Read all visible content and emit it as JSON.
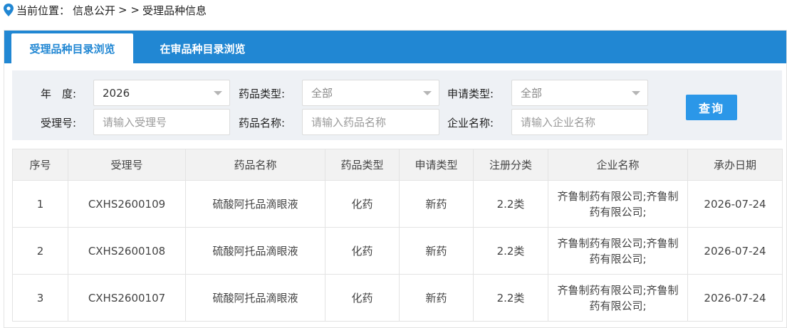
{
  "breadcrumb": {
    "prefix": "当前位置：",
    "item1": "信息公开",
    "separator": "> >",
    "item2": "受理品种信息"
  },
  "tabs": [
    {
      "label": "受理品种目录浏览",
      "active": true
    },
    {
      "label": "在审品种目录浏览",
      "active": false
    }
  ],
  "filters": {
    "year_label": "年　度:",
    "year_value": "2026",
    "drug_type_label": "药品类型:",
    "drug_type_value": "全部",
    "apply_type_label": "申请类型:",
    "apply_type_value": "全部",
    "accept_no_label": "受理号:",
    "accept_no_placeholder": "请输入受理号",
    "drug_name_label": "药品名称:",
    "drug_name_placeholder": "请输入药品名称",
    "company_label": "企业名称:",
    "company_placeholder": "请输入企业名称",
    "search_button": "查询"
  },
  "table": {
    "columns": [
      "序号",
      "受理号",
      "药品名称",
      "药品类型",
      "申请类型",
      "注册分类",
      "企业名称",
      "承办日期"
    ],
    "rows": [
      {
        "no": "1",
        "accept_no": "CXHS2600109",
        "drug_name": "硫酸阿托品滴眼液",
        "drug_type": "化药",
        "apply_type": "新药",
        "reg_class": "2.2类",
        "company": "齐鲁制药有限公司;齐鲁制药有限公司;",
        "date": "2026-07-24"
      },
      {
        "no": "2",
        "accept_no": "CXHS2600108",
        "drug_name": "硫酸阿托品滴眼液",
        "drug_type": "化药",
        "apply_type": "新药",
        "reg_class": "2.2类",
        "company": "齐鲁制药有限公司;齐鲁制药有限公司;",
        "date": "2026-07-24"
      },
      {
        "no": "3",
        "accept_no": "CXHS2600107",
        "drug_name": "硫酸阿托品滴眼液",
        "drug_type": "化药",
        "apply_type": "新药",
        "reg_class": "2.2类",
        "company": "齐鲁制药有限公司;齐鲁制药有限公司;",
        "date": "2026-07-24"
      }
    ]
  },
  "colors": {
    "tab_bar": "#2187d3",
    "search_button": "#2b97e8"
  },
  "icons": {
    "location": "location-pin-icon",
    "dropdown": "chevron-down-icon"
  }
}
